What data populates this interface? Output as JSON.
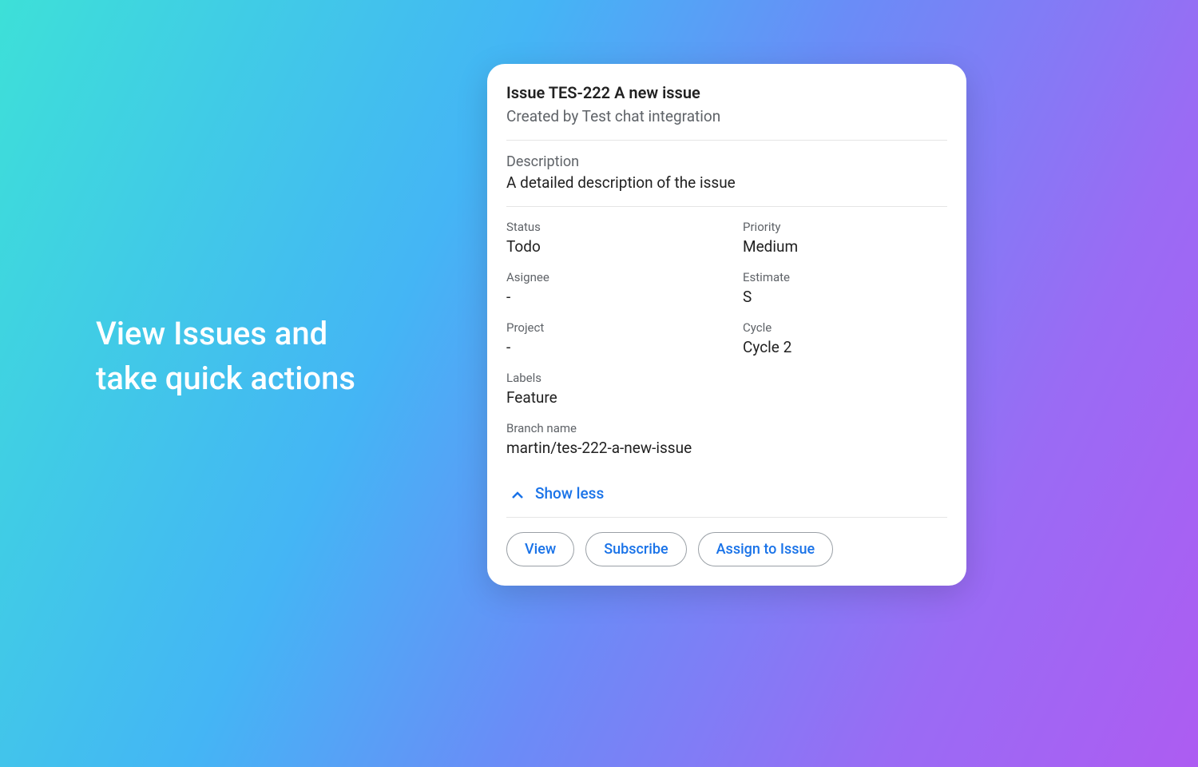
{
  "headline": {
    "line1": "View Issues and",
    "line2": "take quick actions"
  },
  "card": {
    "header": {
      "title": "Issue TES-222 A new issue",
      "created_by": "Created by Test chat integration"
    },
    "description": {
      "label": "Description",
      "value": "A detailed description of the issue"
    },
    "fields": {
      "status": {
        "label": "Status",
        "value": "Todo"
      },
      "priority": {
        "label": "Priority",
        "value": "Medium"
      },
      "assignee": {
        "label": "Asignee",
        "value": "-"
      },
      "estimate": {
        "label": "Estimate",
        "value": "S"
      },
      "project": {
        "label": "Project",
        "value": "-"
      },
      "cycle": {
        "label": "Cycle",
        "value": "Cycle 2"
      },
      "labels": {
        "label": "Labels",
        "value": "Feature"
      },
      "branch": {
        "label": "Branch name",
        "value": "martin/tes-222-a-new-issue"
      }
    },
    "toggle": {
      "label": "Show less"
    },
    "actions": {
      "view": "View",
      "subscribe": "Subscribe",
      "assign": "Assign to Issue"
    }
  }
}
